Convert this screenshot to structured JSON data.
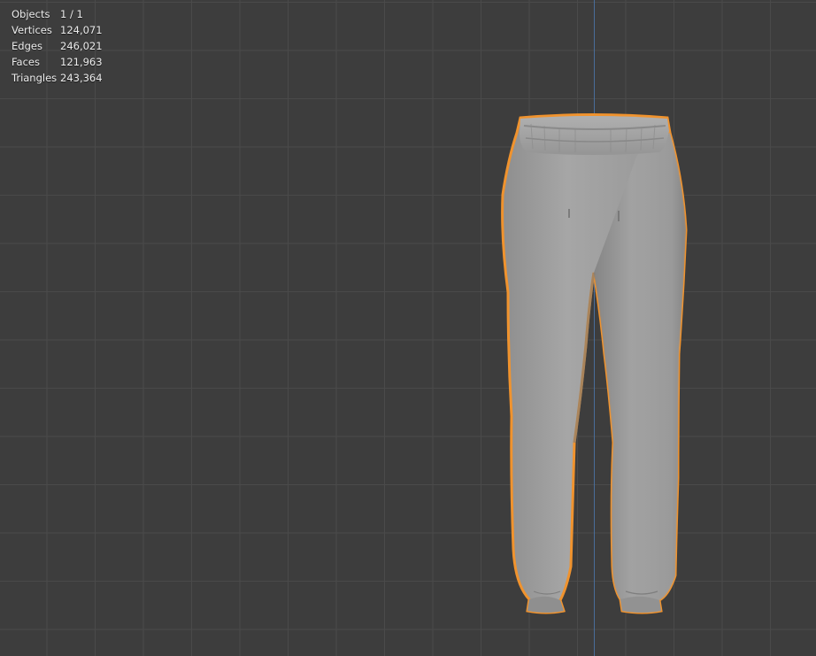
{
  "viewport": {
    "stats": [
      {
        "label": "Objects",
        "value": "1 / 1"
      },
      {
        "label": "Vertices",
        "value": "124,071"
      },
      {
        "label": "Edges",
        "value": "246,021"
      },
      {
        "label": "Faces",
        "value": "121,963"
      },
      {
        "label": "Triangles",
        "value": "243,364"
      }
    ],
    "selection_outline_color": "#f0932e",
    "mesh_color": "#9c9c9c",
    "axis_color": "#4a6e9a"
  }
}
